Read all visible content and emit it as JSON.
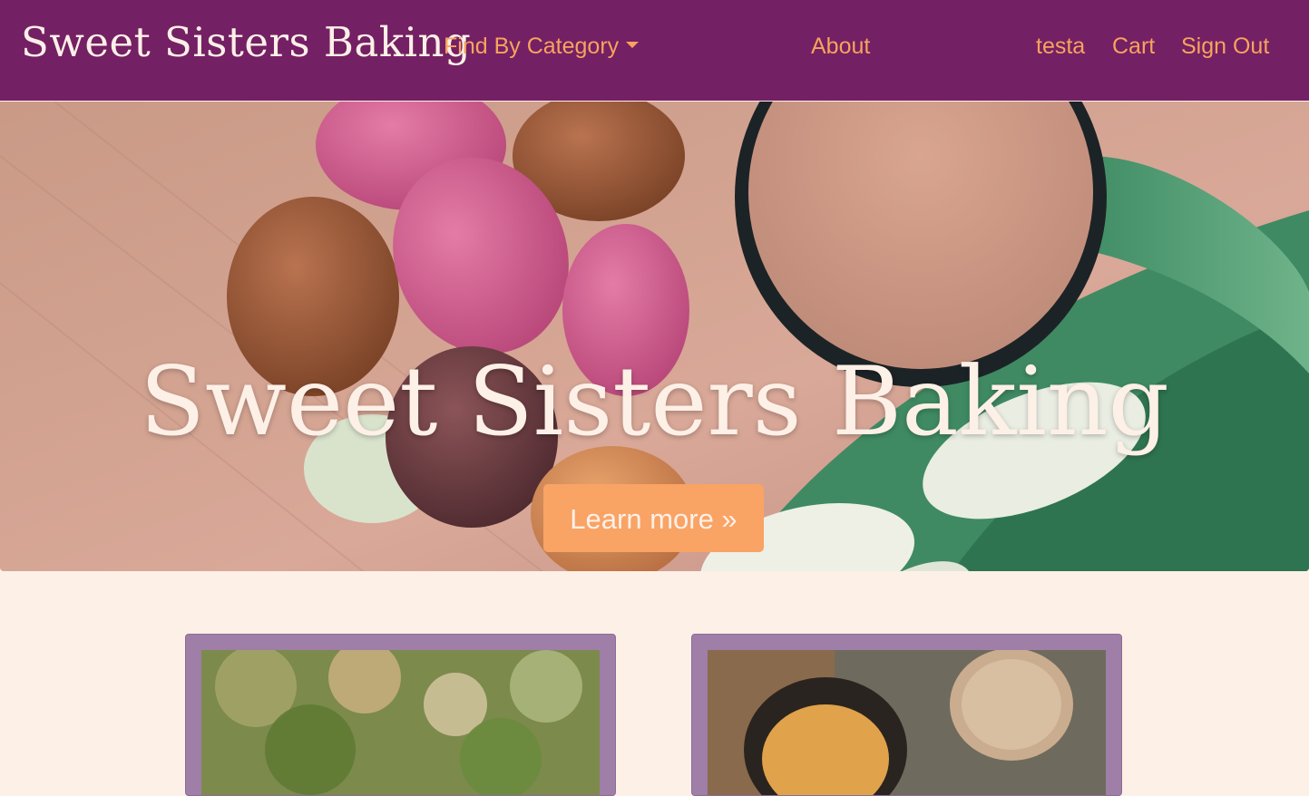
{
  "navbar": {
    "brand": "Sweet Sisters Baking",
    "category_label": "Find By Category",
    "about_label": "About",
    "user_label": "testa",
    "cart_label": "Cart",
    "signout_label": "Sign Out"
  },
  "hero": {
    "title": "Sweet Sisters Baking",
    "button_label": "Learn more »"
  },
  "colors": {
    "navbar_bg": "#742064",
    "nav_link": "#f7a35e",
    "page_bg": "#fdf0e7",
    "button_bg": "#f9a365",
    "card_frame": "#9f7ea8"
  }
}
